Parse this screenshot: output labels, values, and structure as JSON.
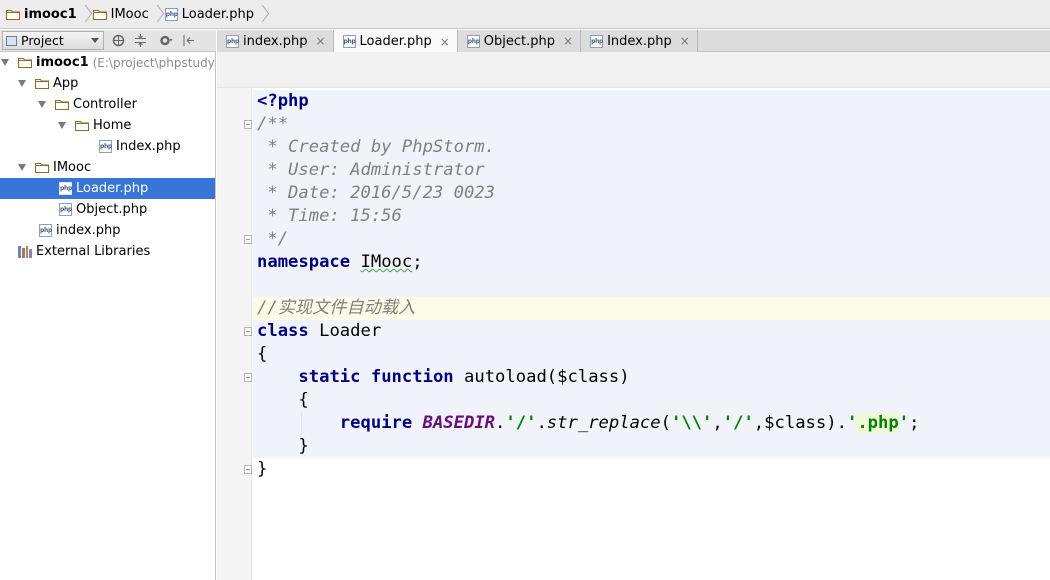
{
  "breadcrumb": {
    "items": [
      {
        "label": "imooc1",
        "icon": "folder-icon"
      },
      {
        "label": "IMooc",
        "icon": "folder-icon"
      },
      {
        "label": "Loader.php",
        "icon": "php-file-icon"
      }
    ]
  },
  "project_panel": {
    "view_label": "Project",
    "tools": [
      "sync-icon",
      "collapse-icon",
      "settings-icon",
      "hide-icon"
    ]
  },
  "tabs": [
    {
      "label": "index.php",
      "active": false
    },
    {
      "label": "Loader.php",
      "active": true
    },
    {
      "label": "Object.php",
      "active": false
    },
    {
      "label": "Index.php",
      "active": false
    }
  ],
  "tab_close_glyph": "×",
  "php_icon_text": "php",
  "tree": {
    "root_label": "imooc1",
    "root_path": "(E:\\project\\phpstudy\\W",
    "app": "App",
    "controller": "Controller",
    "home": "Home",
    "home_index": "Index.php",
    "imooc": "IMooc",
    "loader": "Loader.php",
    "object": "Object.php",
    "root_index": "index.php",
    "external": "External Libraries"
  },
  "code": {
    "php_open": "<?php",
    "doc_open": "/**",
    "doc_created": " * Created by PhpStorm.",
    "doc_user": " * User: Administrator",
    "doc_date": " * Date: 2016/5/23 0023",
    "doc_time": " * Time: 15:56",
    "doc_close": " */",
    "namespace_kw": "namespace",
    "namespace_name": "IMooc",
    "semicolon": ";",
    "comment": "//实现文件自动载入",
    "class_kw": "class",
    "class_name": "Loader",
    "brace_open": "{",
    "brace_close": "}",
    "static_kw": "static",
    "function_kw": "function",
    "method_sig": "autoload($class)",
    "require_kw": "require",
    "const_name": "BASEDIR",
    "dot": ".",
    "str_slash": "'/'",
    "fn_name": "str_replace",
    "paren_open": "(",
    "str_backslash": "'\\\\'",
    "comma": ",",
    "var_class": "$class",
    "paren_close": ")",
    "quote": "'",
    "str_ext": ".php"
  }
}
